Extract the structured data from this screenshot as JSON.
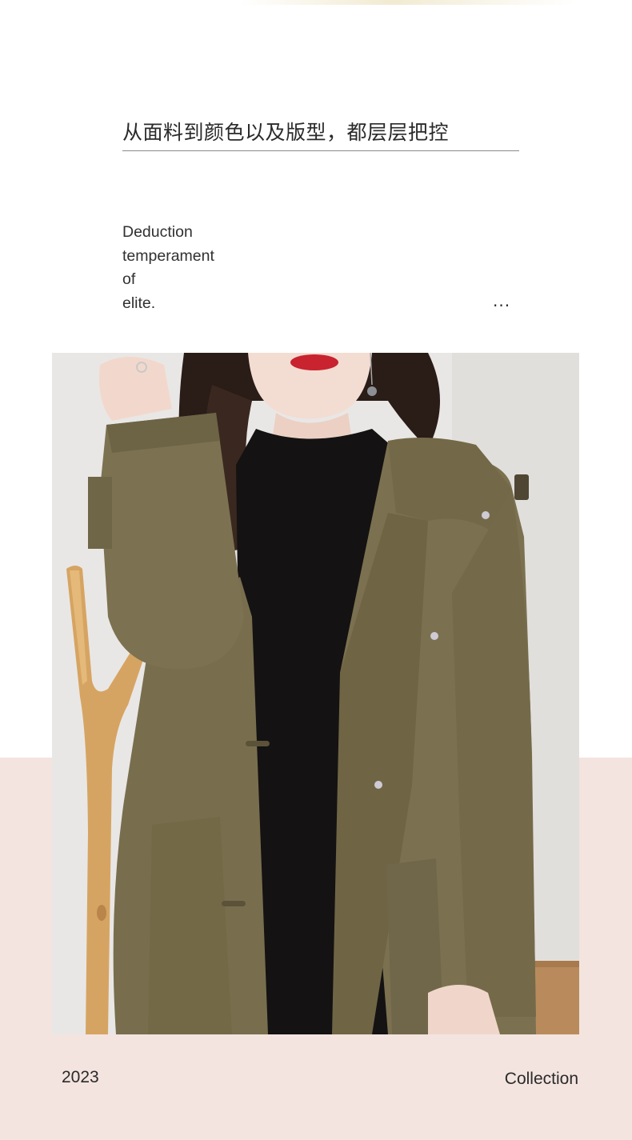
{
  "header": {
    "headline": "从面料到颜色以及版型，都层层把控"
  },
  "tagline": {
    "lines": [
      "Deduction",
      "temperament",
      "of",
      "elite."
    ],
    "ellipsis": "..."
  },
  "photo": {
    "subject": "olive-wool-hooded-coat",
    "colors": {
      "coat": "#7a7050",
      "sweater": "#141212",
      "wall": "#e8e6e4",
      "branch": "#d9a864"
    }
  },
  "footer": {
    "year": "2023",
    "label": "Collection"
  },
  "colors": {
    "background": "#ffffff",
    "bottom_band": "#f3e4df",
    "text": "#2a2a2a"
  }
}
